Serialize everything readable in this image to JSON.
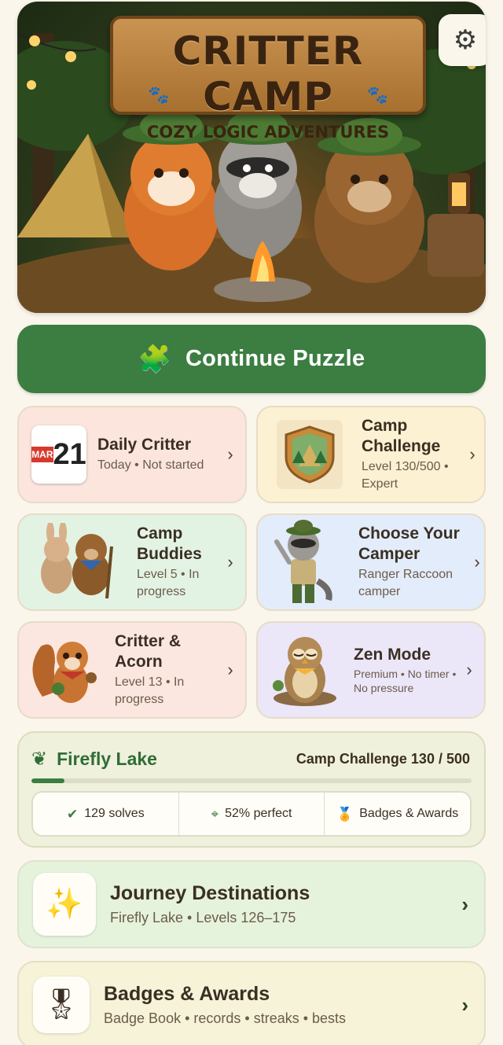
{
  "hero": {
    "sign_title": "CRITTER CAMP",
    "sign_subtitle": "COZY LOGIC ADVENTURES",
    "characters": [
      "fox",
      "raccoon",
      "bear"
    ],
    "settings_icon": "gear-icon"
  },
  "continue_button": {
    "label": "Continue Puzzle",
    "icon": "puzzle-piece-icon"
  },
  "cards": {
    "daily": {
      "calendar_month": "MAR",
      "calendar_day": "21",
      "title": "Daily Critter",
      "subtitle": "Today • Not started"
    },
    "challenge": {
      "title": "Camp Challenge",
      "subtitle": "Level 130/500 • Expert"
    },
    "buddies": {
      "title": "Camp Buddies",
      "subtitle": "Level 5 • In progress"
    },
    "camper": {
      "title": "Choose Your Camper",
      "subtitle": "Ranger Raccoon camper"
    },
    "acorn": {
      "title": "Critter & Acorn",
      "subtitle": "Level 13 • In progress"
    },
    "zen": {
      "title": "Zen Mode",
      "subtitle": "Premium • No timer • No pressure"
    }
  },
  "lake": {
    "name": "Firefly Lake",
    "progress_label": "Camp Challenge 130 / 500",
    "progress_fraction": 0.075,
    "stats": {
      "solves": "129 solves",
      "perfect": "52% perfect",
      "badges": "Badges & Awards"
    }
  },
  "journey": {
    "title": "Journey Destinations",
    "subtitle": "Firefly Lake • Levels 126–175"
  },
  "badges": {
    "title": "Badges & Awards",
    "subtitle": "Badge Book • records • streaks • bests"
  },
  "colors": {
    "primary_green": "#3c7d42",
    "page_bg": "#fbf6ec",
    "card_daily": "#fbe5dd",
    "card_challenge": "#fcf1d2",
    "card_buddies": "#e2f3e4",
    "card_camper": "#e3ecfa",
    "card_acorn": "#fbe7df",
    "card_zen": "#ece6f9"
  }
}
